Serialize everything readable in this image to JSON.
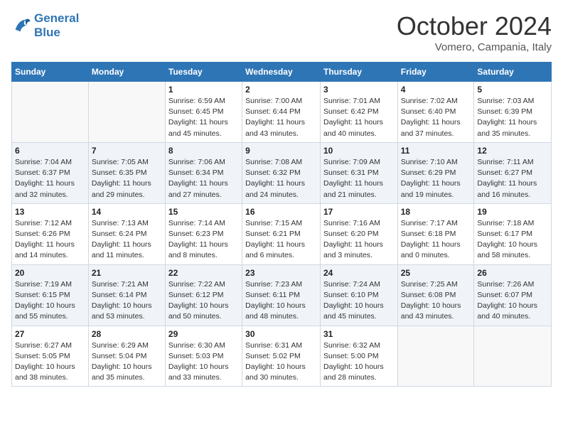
{
  "header": {
    "logo_line1": "General",
    "logo_line2": "Blue",
    "month": "October 2024",
    "location": "Vomero, Campania, Italy"
  },
  "weekdays": [
    "Sunday",
    "Monday",
    "Tuesday",
    "Wednesday",
    "Thursday",
    "Friday",
    "Saturday"
  ],
  "weeks": [
    [
      {
        "day": "",
        "info": ""
      },
      {
        "day": "",
        "info": ""
      },
      {
        "day": "1",
        "info": "Sunrise: 6:59 AM\nSunset: 6:45 PM\nDaylight: 11 hours and 45 minutes."
      },
      {
        "day": "2",
        "info": "Sunrise: 7:00 AM\nSunset: 6:44 PM\nDaylight: 11 hours and 43 minutes."
      },
      {
        "day": "3",
        "info": "Sunrise: 7:01 AM\nSunset: 6:42 PM\nDaylight: 11 hours and 40 minutes."
      },
      {
        "day": "4",
        "info": "Sunrise: 7:02 AM\nSunset: 6:40 PM\nDaylight: 11 hours and 37 minutes."
      },
      {
        "day": "5",
        "info": "Sunrise: 7:03 AM\nSunset: 6:39 PM\nDaylight: 11 hours and 35 minutes."
      }
    ],
    [
      {
        "day": "6",
        "info": "Sunrise: 7:04 AM\nSunset: 6:37 PM\nDaylight: 11 hours and 32 minutes."
      },
      {
        "day": "7",
        "info": "Sunrise: 7:05 AM\nSunset: 6:35 PM\nDaylight: 11 hours and 29 minutes."
      },
      {
        "day": "8",
        "info": "Sunrise: 7:06 AM\nSunset: 6:34 PM\nDaylight: 11 hours and 27 minutes."
      },
      {
        "day": "9",
        "info": "Sunrise: 7:08 AM\nSunset: 6:32 PM\nDaylight: 11 hours and 24 minutes."
      },
      {
        "day": "10",
        "info": "Sunrise: 7:09 AM\nSunset: 6:31 PM\nDaylight: 11 hours and 21 minutes."
      },
      {
        "day": "11",
        "info": "Sunrise: 7:10 AM\nSunset: 6:29 PM\nDaylight: 11 hours and 19 minutes."
      },
      {
        "day": "12",
        "info": "Sunrise: 7:11 AM\nSunset: 6:27 PM\nDaylight: 11 hours and 16 minutes."
      }
    ],
    [
      {
        "day": "13",
        "info": "Sunrise: 7:12 AM\nSunset: 6:26 PM\nDaylight: 11 hours and 14 minutes."
      },
      {
        "day": "14",
        "info": "Sunrise: 7:13 AM\nSunset: 6:24 PM\nDaylight: 11 hours and 11 minutes."
      },
      {
        "day": "15",
        "info": "Sunrise: 7:14 AM\nSunset: 6:23 PM\nDaylight: 11 hours and 8 minutes."
      },
      {
        "day": "16",
        "info": "Sunrise: 7:15 AM\nSunset: 6:21 PM\nDaylight: 11 hours and 6 minutes."
      },
      {
        "day": "17",
        "info": "Sunrise: 7:16 AM\nSunset: 6:20 PM\nDaylight: 11 hours and 3 minutes."
      },
      {
        "day": "18",
        "info": "Sunrise: 7:17 AM\nSunset: 6:18 PM\nDaylight: 11 hours and 0 minutes."
      },
      {
        "day": "19",
        "info": "Sunrise: 7:18 AM\nSunset: 6:17 PM\nDaylight: 10 hours and 58 minutes."
      }
    ],
    [
      {
        "day": "20",
        "info": "Sunrise: 7:19 AM\nSunset: 6:15 PM\nDaylight: 10 hours and 55 minutes."
      },
      {
        "day": "21",
        "info": "Sunrise: 7:21 AM\nSunset: 6:14 PM\nDaylight: 10 hours and 53 minutes."
      },
      {
        "day": "22",
        "info": "Sunrise: 7:22 AM\nSunset: 6:12 PM\nDaylight: 10 hours and 50 minutes."
      },
      {
        "day": "23",
        "info": "Sunrise: 7:23 AM\nSunset: 6:11 PM\nDaylight: 10 hours and 48 minutes."
      },
      {
        "day": "24",
        "info": "Sunrise: 7:24 AM\nSunset: 6:10 PM\nDaylight: 10 hours and 45 minutes."
      },
      {
        "day": "25",
        "info": "Sunrise: 7:25 AM\nSunset: 6:08 PM\nDaylight: 10 hours and 43 minutes."
      },
      {
        "day": "26",
        "info": "Sunrise: 7:26 AM\nSunset: 6:07 PM\nDaylight: 10 hours and 40 minutes."
      }
    ],
    [
      {
        "day": "27",
        "info": "Sunrise: 6:27 AM\nSunset: 5:05 PM\nDaylight: 10 hours and 38 minutes."
      },
      {
        "day": "28",
        "info": "Sunrise: 6:29 AM\nSunset: 5:04 PM\nDaylight: 10 hours and 35 minutes."
      },
      {
        "day": "29",
        "info": "Sunrise: 6:30 AM\nSunset: 5:03 PM\nDaylight: 10 hours and 33 minutes."
      },
      {
        "day": "30",
        "info": "Sunrise: 6:31 AM\nSunset: 5:02 PM\nDaylight: 10 hours and 30 minutes."
      },
      {
        "day": "31",
        "info": "Sunrise: 6:32 AM\nSunset: 5:00 PM\nDaylight: 10 hours and 28 minutes."
      },
      {
        "day": "",
        "info": ""
      },
      {
        "day": "",
        "info": ""
      }
    ]
  ]
}
